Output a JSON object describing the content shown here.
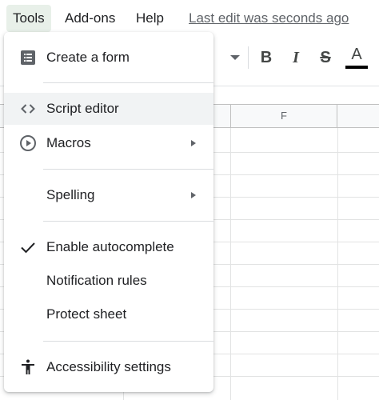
{
  "menubar": {
    "items": [
      {
        "label": "Tools",
        "active": true
      },
      {
        "label": "Add-ons"
      },
      {
        "label": "Help"
      }
    ],
    "last_edit": "Last edit was seconds ago"
  },
  "toolbar": {
    "bold": "B",
    "italic": "I",
    "strikethrough": "S",
    "text_color": "A",
    "text_color_value": "#000000"
  },
  "grid": {
    "visible_column": "F"
  },
  "tools_menu": {
    "items": [
      {
        "label": "Create a form",
        "icon": "form-icon"
      },
      {
        "label": "Script editor",
        "icon": "code-icon",
        "highlighted": true
      },
      {
        "label": "Macros",
        "icon": "play-circle-icon",
        "submenu": true
      },
      {
        "label": "Spelling",
        "submenu": true
      },
      {
        "label": "Enable autocomplete",
        "icon": "checkmark-icon",
        "checked": true
      },
      {
        "label": "Notification rules"
      },
      {
        "label": "Protect sheet"
      },
      {
        "label": "Accessibility settings",
        "icon": "accessibility-icon"
      }
    ]
  },
  "colors": {
    "active_menu_bg": "#e8f0e9",
    "hover_bg": "#f1f3f4",
    "text": "#202124",
    "icon": "#5f6368"
  }
}
